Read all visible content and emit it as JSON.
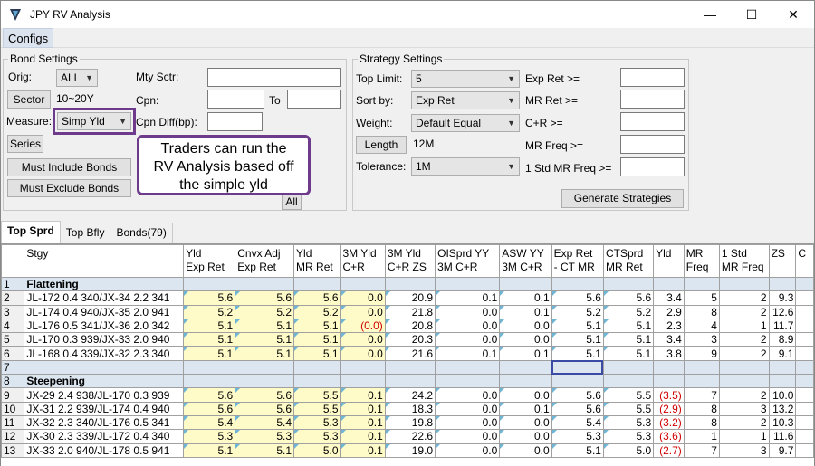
{
  "window": {
    "title": "JPY RV Analysis",
    "minimize": "—",
    "maximize": "☐",
    "close": "✕"
  },
  "menu": {
    "configs": "Configs"
  },
  "bond_settings": {
    "title": "Bond Settings",
    "orig_label": "Orig:",
    "orig_value": "ALL",
    "mty_sctr_label": "Mty Sctr:",
    "sector_button": "Sector",
    "sector_value": "10~20Y",
    "cpn_label": "Cpn:",
    "to_label": "To",
    "measure_label": "Measure:",
    "measure_value": "Simp Yld",
    "cpn_diff_label": "Cpn Diff(bp):",
    "series_button": "Series",
    "must_include_button": "Must Include Bonds",
    "must_exclude_button": "Must Exclude Bonds",
    "all_button": "All"
  },
  "callout": {
    "line1": "Traders can run the",
    "line2": "RV Analysis based off",
    "line3": "the simple yld"
  },
  "strategy_settings": {
    "title": "Strategy Settings",
    "top_limit_label": "Top Limit:",
    "top_limit_value": "5",
    "sort_by_label": "Sort by:",
    "sort_by_value": "Exp Ret",
    "weight_label": "Weight:",
    "weight_value": "Default Equal",
    "length_button": "Length",
    "length_value": "12M",
    "tolerance_label": "Tolerance:",
    "tolerance_value": "1M",
    "exp_ret_label": "Exp Ret >=",
    "mr_ret_label": "MR Ret >=",
    "cr_label": "C+R >=",
    "mr_freq_label": "MR Freq >=",
    "std_mr_freq_label": "1 Std MR Freq >=",
    "generate_button": "Generate Strategies"
  },
  "tabs": [
    "Top Sprd",
    "Top Bfly",
    "Bonds(79)"
  ],
  "grid": {
    "headers": [
      [
        "Stgy",
        ""
      ],
      [
        "Yld",
        "Exp Ret"
      ],
      [
        "Cnvx Adj",
        "Exp Ret"
      ],
      [
        "Yld",
        "MR Ret"
      ],
      [
        "3M Yld",
        "C+R"
      ],
      [
        "3M Yld",
        "C+R ZS"
      ],
      [
        "OISprd YY",
        "3M C+R"
      ],
      [
        "ASW YY",
        "3M C+R"
      ],
      [
        "Exp Ret",
        "- CT MR"
      ],
      [
        "CTSprd",
        "MR Ret"
      ],
      [
        "Yld",
        ""
      ],
      [
        "MR",
        "Freq"
      ],
      [
        "1 Std",
        "MR Freq"
      ],
      [
        "ZS",
        ""
      ],
      [
        "C",
        ""
      ]
    ],
    "rows": [
      {
        "n": "1",
        "type": "group",
        "stgy": "Flattening"
      },
      {
        "n": "2",
        "type": "data",
        "stgy": "JL-172 0.4 340/JX-34 2.2 341",
        "v": [
          "5.6",
          "5.6",
          "5.6",
          "0.0",
          "20.9",
          "0.1",
          "0.1",
          "5.6",
          "5.6",
          "3.4",
          "5",
          "2",
          "9.3"
        ]
      },
      {
        "n": "3",
        "type": "data",
        "stgy": "JL-174 0.4 940/JX-35 2.0 941",
        "v": [
          "5.2",
          "5.2",
          "5.2",
          "0.0",
          "21.8",
          "0.0",
          "0.1",
          "5.2",
          "5.2",
          "2.9",
          "8",
          "2",
          "12.6"
        ]
      },
      {
        "n": "4",
        "type": "data",
        "stgy": "JL-176 0.5 341/JX-36 2.0 342",
        "v": [
          "5.1",
          "5.1",
          "5.1",
          "(0.0)",
          "20.8",
          "0.0",
          "0.0",
          "5.1",
          "5.1",
          "2.3",
          "4",
          "1",
          "11.7"
        ],
        "red": [
          3
        ]
      },
      {
        "n": "5",
        "type": "data",
        "stgy": "JL-170 0.3 939/JX-33 2.0 940",
        "v": [
          "5.1",
          "5.1",
          "5.1",
          "0.0",
          "20.3",
          "0.0",
          "0.0",
          "5.1",
          "5.1",
          "3.4",
          "3",
          "2",
          "8.9"
        ]
      },
      {
        "n": "6",
        "type": "data",
        "stgy": "JL-168 0.4 339/JX-32 2.3 340",
        "v": [
          "5.1",
          "5.1",
          "5.1",
          "0.0",
          "21.6",
          "0.1",
          "0.1",
          "5.1",
          "5.1",
          "3.8",
          "9",
          "2",
          "9.1"
        ]
      },
      {
        "n": "7",
        "type": "empty"
      },
      {
        "n": "8",
        "type": "group",
        "stgy": "Steepening"
      },
      {
        "n": "9",
        "type": "data",
        "stgy": "JX-29 2.4 938/JL-170 0.3 939",
        "v": [
          "5.6",
          "5.6",
          "5.5",
          "0.1",
          "24.2",
          "0.0",
          "0.0",
          "5.6",
          "5.5",
          "(3.5)",
          "7",
          "2",
          "10.0"
        ],
        "red": [
          9
        ]
      },
      {
        "n": "10",
        "type": "data",
        "stgy": "JX-31 2.2 939/JL-174 0.4 940",
        "v": [
          "5.6",
          "5.6",
          "5.5",
          "0.1",
          "18.3",
          "0.0",
          "0.1",
          "5.6",
          "5.5",
          "(2.9)",
          "8",
          "3",
          "13.2"
        ],
        "red": [
          9
        ]
      },
      {
        "n": "11",
        "type": "data",
        "stgy": "JX-32 2.3 340/JL-176 0.5 341",
        "v": [
          "5.4",
          "5.4",
          "5.3",
          "0.1",
          "19.8",
          "0.0",
          "0.0",
          "5.4",
          "5.3",
          "(3.2)",
          "8",
          "2",
          "10.3"
        ],
        "red": [
          9
        ]
      },
      {
        "n": "12",
        "type": "data",
        "stgy": "JX-30 2.3 339/JL-172 0.4 340",
        "v": [
          "5.3",
          "5.3",
          "5.3",
          "0.1",
          "22.6",
          "0.0",
          "0.0",
          "5.3",
          "5.3",
          "(3.6)",
          "1",
          "1",
          "11.6"
        ],
        "red": [
          9
        ]
      },
      {
        "n": "13",
        "type": "data",
        "stgy": "JX-33 2.0 940/JL-178 0.5 941",
        "v": [
          "5.1",
          "5.1",
          "5.0",
          "0.1",
          "19.0",
          "0.0",
          "0.0",
          "5.1",
          "5.0",
          "(2.7)",
          "7",
          "3",
          "9.7"
        ],
        "red": [
          9
        ]
      }
    ]
  },
  "colors": {
    "accent": "#6d3a8c",
    "highlight_cell": "#fffbc9",
    "group_row": "#dce6f1",
    "negative": "#d00000"
  }
}
